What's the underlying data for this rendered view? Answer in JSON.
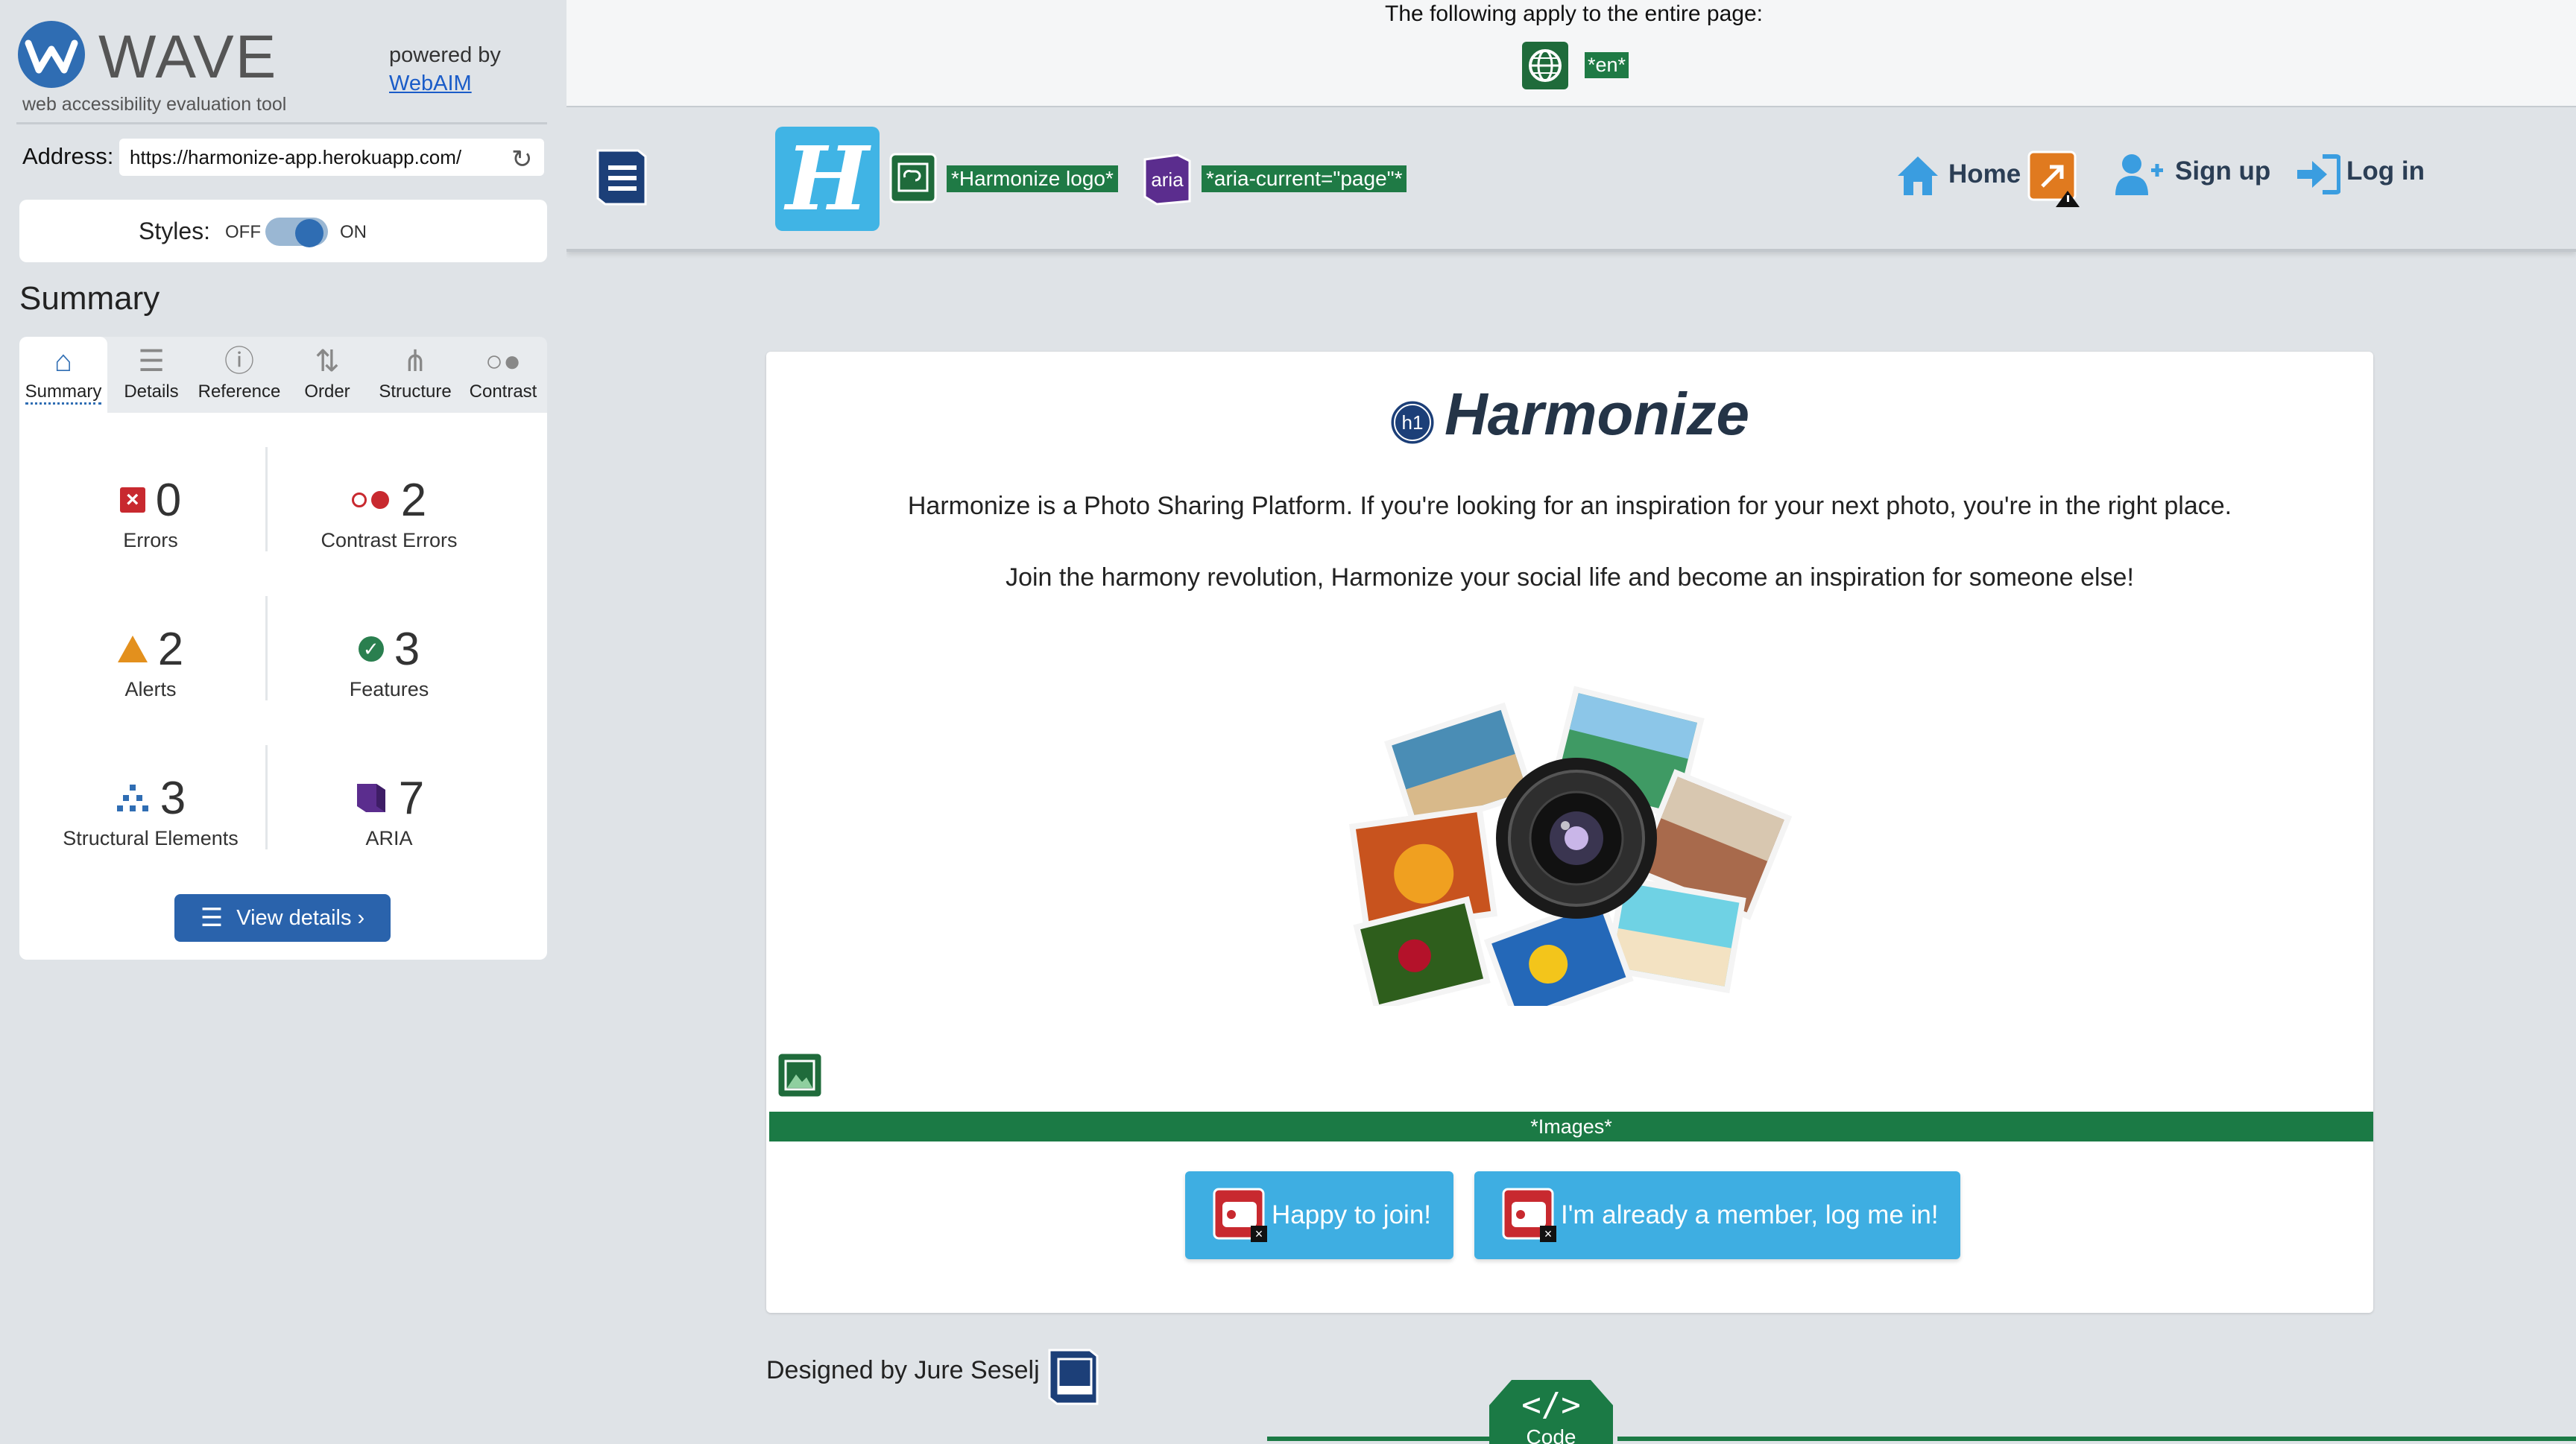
{
  "sidebar": {
    "logo_text": "WAVE",
    "subtitle": "web accessibility evaluation tool",
    "powered_by": "powered by",
    "webaim_link": "WebAIM",
    "address_label": "Address:",
    "address_value": "https://harmonize-app.herokuapp.com/",
    "styles_label": "Styles:",
    "styles_off": "OFF",
    "styles_on": "ON",
    "styles_state": "on",
    "summary_heading": "Summary",
    "tabs": [
      {
        "label": "Summary",
        "icon": "home-icon"
      },
      {
        "label": "Details",
        "icon": "list-icon"
      },
      {
        "label": "Reference",
        "icon": "info-icon"
      },
      {
        "label": "Order",
        "icon": "order-icon"
      },
      {
        "label": "Structure",
        "icon": "structure-icon"
      },
      {
        "label": "Contrast",
        "icon": "contrast-icon"
      }
    ],
    "active_tab": "Summary",
    "stats": {
      "errors": {
        "count": "0",
        "label": "Errors"
      },
      "contrast_errors": {
        "count": "2",
        "label": "Contrast Errors"
      },
      "alerts": {
        "count": "2",
        "label": "Alerts"
      },
      "features": {
        "count": "3",
        "label": "Features"
      },
      "structural": {
        "count": "3",
        "label": "Structural Elements"
      },
      "aria": {
        "count": "7",
        "label": "ARIA"
      }
    },
    "view_details": "View details ›"
  },
  "preview": {
    "page_notice": "The following apply to the entire page:",
    "lang_tag": "*en*",
    "logo_letter": "H",
    "logo_alt_tag": "*Harmonize logo*",
    "aria_badge": "aria",
    "aria_current_tag": "*aria-current=\"page\"*",
    "nav": {
      "home": "Home",
      "signup": "Sign up",
      "login": "Log in"
    },
    "h1_badge": "h1",
    "title": "Harmonize",
    "paragraph1": "Harmonize is a Photo Sharing Platform. If you're looking for an inspiration for your next photo, you're in the right place.",
    "paragraph2": "Join the harmony revolution, Harmonize your social life and become an inspiration for someone else!",
    "images_bar": "*Images*",
    "cta_join": "Happy to join!",
    "cta_login": "I'm already a member, log me in!",
    "footer": "Designed by Jure Seselj",
    "code_button": "Code"
  },
  "colors": {
    "wave_blue": "#2f6db3",
    "error_red": "#c8292f",
    "alert_orange": "#e3901d",
    "feature_green": "#2a7f4f",
    "aria_purple": "#5b2d8e",
    "harmonize_blue": "#3eaee2",
    "tag_green": "#1f7a45"
  }
}
